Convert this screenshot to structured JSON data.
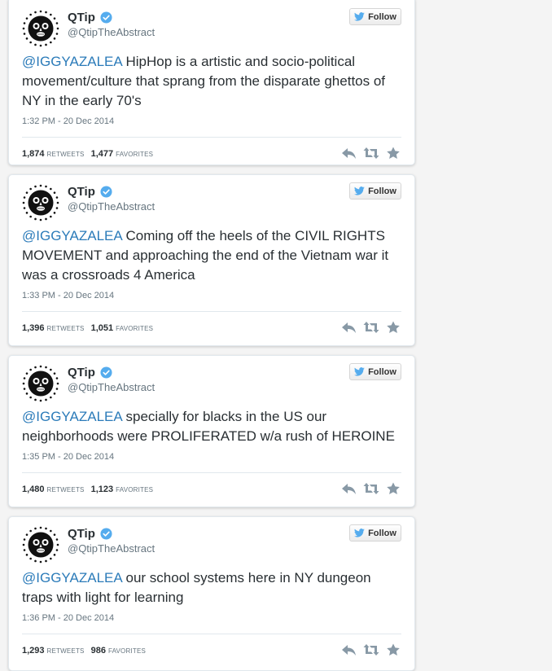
{
  "colors": {
    "mention": "#2b7bb9",
    "twitter_bird": "#55acee",
    "verified_badge": "#55acee",
    "action_icons": "#8899a6"
  },
  "tweets": [
    {
      "name": "QTip",
      "handle": "@QtipTheAbstract",
      "follow_label": "Follow",
      "mention": "@IGGYAZALEA",
      "text": " HipHop is a artistic and socio-political movement/culture that sprang from the disparate ghettos of NY in the early 70's",
      "timestamp": "1:32 PM - 20 Dec 2014",
      "retweets": "1,874",
      "retweets_label": "RETWEETS",
      "favorites": "1,477",
      "favorites_label": "FAVORITES",
      "avatar_text": "ZULU NATION",
      "icons": [
        "reply-icon",
        "retweet-icon",
        "favorite-icon"
      ]
    },
    {
      "name": "QTip",
      "handle": "@QtipTheAbstract",
      "follow_label": "Follow",
      "mention": "@IGGYAZALEA",
      "text": " Coming off the heels of the CIVIL RIGHTS MOVEMENT and approaching the end of the Vietnam war it was a crossroads 4 America",
      "timestamp": "1:33 PM - 20 Dec 2014",
      "retweets": "1,396",
      "retweets_label": "RETWEETS",
      "favorites": "1,051",
      "favorites_label": "FAVORITES",
      "avatar_text": "ZULU NATION",
      "icons": [
        "reply-icon",
        "retweet-icon",
        "favorite-icon"
      ]
    },
    {
      "name": "QTip",
      "handle": "@QtipTheAbstract",
      "follow_label": "Follow",
      "mention": "@IGGYAZALEA",
      "text": " specially for blacks in the US our neighborhoods were PROLIFERATED w/a rush of HEROINE",
      "timestamp": "1:35 PM - 20 Dec 2014",
      "retweets": "1,480",
      "retweets_label": "RETWEETS",
      "favorites": "1,123",
      "favorites_label": "FAVORITES",
      "avatar_text": "ZULU NATION",
      "icons": [
        "reply-icon",
        "retweet-icon",
        "favorite-icon"
      ]
    },
    {
      "name": "QTip",
      "handle": "@QtipTheAbstract",
      "follow_label": "Follow",
      "mention": "@IGGYAZALEA",
      "text": " our school systems here in NY dungeon traps with light for learning",
      "timestamp": "1:36 PM - 20 Dec 2014",
      "retweets": "1,293",
      "retweets_label": "RETWEETS",
      "favorites": "986",
      "favorites_label": "FAVORITES",
      "avatar_text": "ZULU NATION",
      "icons": [
        "reply-icon",
        "retweet-icon",
        "favorite-icon"
      ]
    }
  ]
}
